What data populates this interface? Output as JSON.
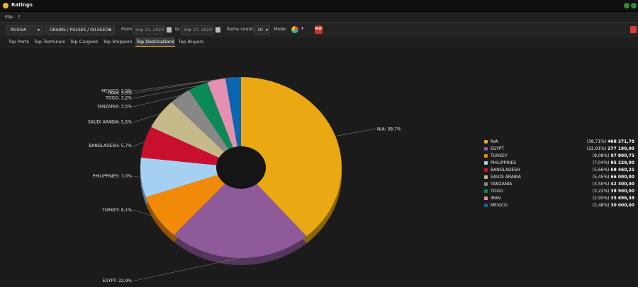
{
  "window": {
    "title": "Ratings"
  },
  "menu": {
    "items": [
      "File",
      "?"
    ]
  },
  "toolbar": {
    "country": "RUSSIA",
    "commodity": "GRAINS / PULSES / OILSEEDS",
    "from_label": "From",
    "from_date": "Sep 21, 2020",
    "to_label": "to",
    "to_date": "Sep 27, 2020",
    "items_count_label": "Items count:",
    "items_count": "10",
    "mode_label": "Mode:",
    "pdf_label": "PDF"
  },
  "tabs": [
    {
      "label": "Top Ports"
    },
    {
      "label": "Top Terminals"
    },
    {
      "label": "Top Cargoes"
    },
    {
      "label": "Top Shippers"
    },
    {
      "label": "Top Destinations"
    },
    {
      "label": "Top Buyers"
    }
  ],
  "active_tab": "Top Destinations",
  "chart_data": {
    "type": "pie",
    "donut": true,
    "legend_position": "right",
    "slices": [
      {
        "name": "N/A",
        "slice_label": "N/A: 38,7%",
        "percent_label": "(38,71%)",
        "value_label": "468 371,78",
        "value": 468371.78,
        "percent": 38.71,
        "color": "#eaa912"
      },
      {
        "name": "EGYPT",
        "slice_label": "EGYPT: 22,9%",
        "percent_label": "(22,91%)",
        "value_label": "277 190,00",
        "value": 277190.0,
        "percent": 22.91,
        "color": "#8e5a9a"
      },
      {
        "name": "TURKEY",
        "slice_label": "TURKEY: 8,1%",
        "percent_label": "(8,08%)",
        "value_label": "97 800,75",
        "value": 97800.75,
        "percent": 8.08,
        "color": "#f08a08"
      },
      {
        "name": "PHILIPPINES",
        "slice_label": "PHILIPPINES: 7,0%",
        "percent_label": "(7,04%)",
        "value_label": "85 229,00",
        "value": 85229.0,
        "percent": 7.04,
        "color": "#a6d0f2"
      },
      {
        "name": "BANGLADESH",
        "slice_label": "BANGLADESH: 5,7%",
        "percent_label": "(5,66%)",
        "value_label": "68 460,21",
        "value": 68460.21,
        "percent": 5.66,
        "color": "#c8102e"
      },
      {
        "name": "SAUDI ARABIA",
        "slice_label": "SAUDI ARABIA: 5,5%",
        "percent_label": "(5,45%)",
        "value_label": "66 000,00",
        "value": 66000.0,
        "percent": 5.45,
        "color": "#c5b98a"
      },
      {
        "name": "TANZANIA",
        "slice_label": "TANZANIA: 3,5%",
        "percent_label": "(3,50%)",
        "value_label": "42 300,00",
        "value": 42300.0,
        "percent": 3.5,
        "color": "#878787"
      },
      {
        "name": "TOGO",
        "slice_label": "TOGO: 3,2%",
        "percent_label": "(3,22%)",
        "value_label": "38 900,00",
        "value": 38900.0,
        "percent": 3.22,
        "color": "#0b8a55"
      },
      {
        "name": "IRAN",
        "slice_label": "IRAN: 3,0%",
        "percent_label": "(2,95%)",
        "value_label": "35 696,38",
        "value": 35696.38,
        "percent": 2.95,
        "color": "#e58fb3"
      },
      {
        "name": "MEXICO",
        "slice_label": "MEXICO: 2,5%",
        "percent_label": "(2,48%)",
        "value_label": "30 000,00",
        "value": 30000.0,
        "percent": 2.48,
        "color": "#0a66b0"
      }
    ]
  }
}
